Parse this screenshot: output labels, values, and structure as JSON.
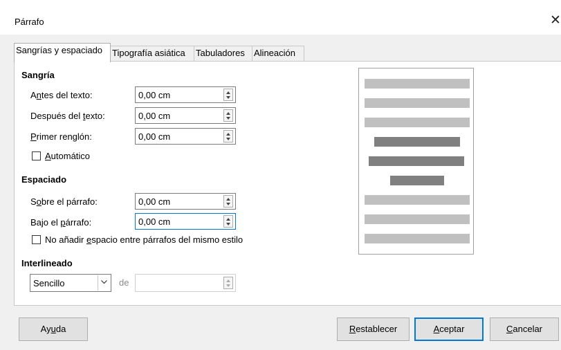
{
  "dialog": {
    "title": "Párrafo"
  },
  "tabs": [
    {
      "label": "Sangrías y espaciado",
      "active": true
    },
    {
      "label": "Tipografía asiática",
      "active": false
    },
    {
      "label": "Tabuladores",
      "active": false
    },
    {
      "label": "Alineación",
      "active": false
    }
  ],
  "indent": {
    "heading": "Sangría",
    "before_label_pre": "A",
    "before_label_ul": "n",
    "before_label_post": "tes del texto:",
    "before_value": "0,00 cm",
    "after_label_pre": "Después del ",
    "after_label_ul": "t",
    "after_label_post": "exto:",
    "after_value": "0,00 cm",
    "first_label_pre": "",
    "first_label_ul": "P",
    "first_label_post": "rimer renglón:",
    "first_value": "0,00 cm",
    "auto_label_pre": "",
    "auto_label_ul": "A",
    "auto_label_post": "utomático",
    "auto_checked": false
  },
  "spacing": {
    "heading": "Espaciado",
    "above_label_pre": "S",
    "above_label_ul": "o",
    "above_label_post": "bre el párrafo:",
    "above_value": "0,00 cm",
    "below_label_pre": "Bajo el ",
    "below_label_ul": "p",
    "below_label_post": "árrafo:",
    "below_value": "0,00 cm",
    "noadd_label_pre": "No añadir ",
    "noadd_label_ul": "e",
    "noadd_label_post": "spacio entre párrafos del mismo estilo",
    "noadd_checked": false
  },
  "line_spacing": {
    "heading": "Interlineado",
    "selected": "Sencillo",
    "of_label": "de",
    "of_value": ""
  },
  "preview": {
    "light_color": "#c0c0c0",
    "dark_color": "#808080"
  },
  "buttons": {
    "help_pre": "Ay",
    "help_ul": "u",
    "help_post": "da",
    "reset_pre": "",
    "reset_ul": "R",
    "reset_post": "establecer",
    "ok_pre": "",
    "ok_ul": "A",
    "ok_post": "ceptar",
    "cancel_pre": "",
    "cancel_ul": "C",
    "cancel_post": "ancelar"
  },
  "colors": {
    "focus": "#0078d7"
  }
}
